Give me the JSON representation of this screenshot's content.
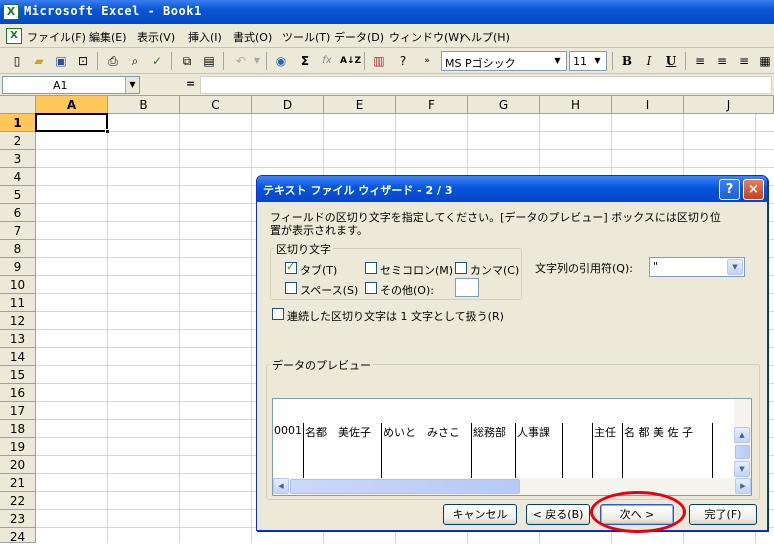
{
  "window": {
    "title": "Microsoft Excel - Book1",
    "app_icon": "excel-icon"
  },
  "menu": {
    "items": [
      "ファイル(F)",
      "編集(E)",
      "表示(V)",
      "挿入(I)",
      "書式(O)",
      "ツール(T)",
      "データ(D)",
      "ウィンドウ(W)",
      "ヘルプ(H)"
    ]
  },
  "toolbar": {
    "font_name": "MS Pゴシック",
    "font_size": "11",
    "sum_symbol": "Σ",
    "fx_symbol": "fx",
    "sort_symbol": "A↓Z",
    "bold": "B",
    "italic": "I",
    "underline": "U"
  },
  "formula_bar": {
    "name_box": "A1",
    "equals": "="
  },
  "sheet": {
    "columns": [
      "A",
      "B",
      "C",
      "D",
      "E",
      "F",
      "G",
      "H",
      "I",
      "J"
    ],
    "rows": [
      "1",
      "2",
      "3",
      "4",
      "5",
      "6",
      "7",
      "8",
      "9",
      "10",
      "11",
      "12",
      "13",
      "14",
      "15",
      "16",
      "17",
      "18",
      "19",
      "20",
      "21",
      "22",
      "23",
      "24"
    ],
    "active_cell": "A1"
  },
  "dialog": {
    "title": "テキスト ファイル ウィザード - 2 / 3",
    "help_label": "?",
    "close_label": "×",
    "instruction_line1": "フィールドの区切り文字を指定してください。[データのプレビュー] ボックスには区切り位",
    "instruction_line2": "置が表示されます。",
    "delimiters": {
      "group_title": "区切り文字",
      "tab": {
        "label": "タブ(T)",
        "checked": true
      },
      "semicolon": {
        "label": "セミコロン(M)",
        "checked": false
      },
      "comma": {
        "label": "カンマ(C)",
        "checked": false
      },
      "space": {
        "label": "スペース(S)",
        "checked": false
      },
      "other": {
        "label": "その他(O):",
        "checked": false,
        "value": ""
      }
    },
    "text_qualifier": {
      "label": "文字列の引用符(Q):",
      "value": "\""
    },
    "consecutive": {
      "label": "連続した区切り文字は 1 文字として扱う(R)",
      "checked": false
    },
    "preview": {
      "group_title": "データのプレビュー",
      "cells": [
        "0001",
        "名都　美佐子",
        "めいと　みさこ",
        "総務部",
        "人事課",
        "",
        "主任",
        "名 都 美 佐 子",
        ""
      ]
    },
    "buttons": {
      "cancel": "キャンセル",
      "back": "< 戻る(B)",
      "next": "次へ >",
      "finish": "完了(F)"
    }
  }
}
